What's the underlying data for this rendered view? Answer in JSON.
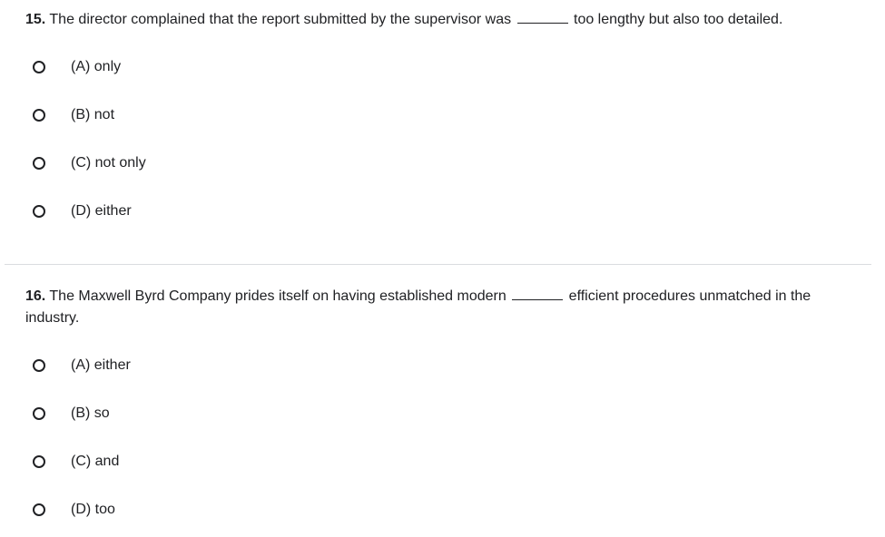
{
  "questions": [
    {
      "number": "15.",
      "text_before": " The director complained that the report submitted by the supervisor was ",
      "text_after": " too lengthy but also too detailed.",
      "options": [
        "(A) only",
        "(B) not",
        "(C) not only",
        "(D) either"
      ]
    },
    {
      "number": "16.",
      "text_before": " The Maxwell Byrd Company prides itself on having established modern ",
      "text_after": " efficient procedures unmatched in the industry.",
      "options": [
        "(A) either",
        "(B) so",
        "(C) and",
        "(D) too"
      ]
    }
  ]
}
